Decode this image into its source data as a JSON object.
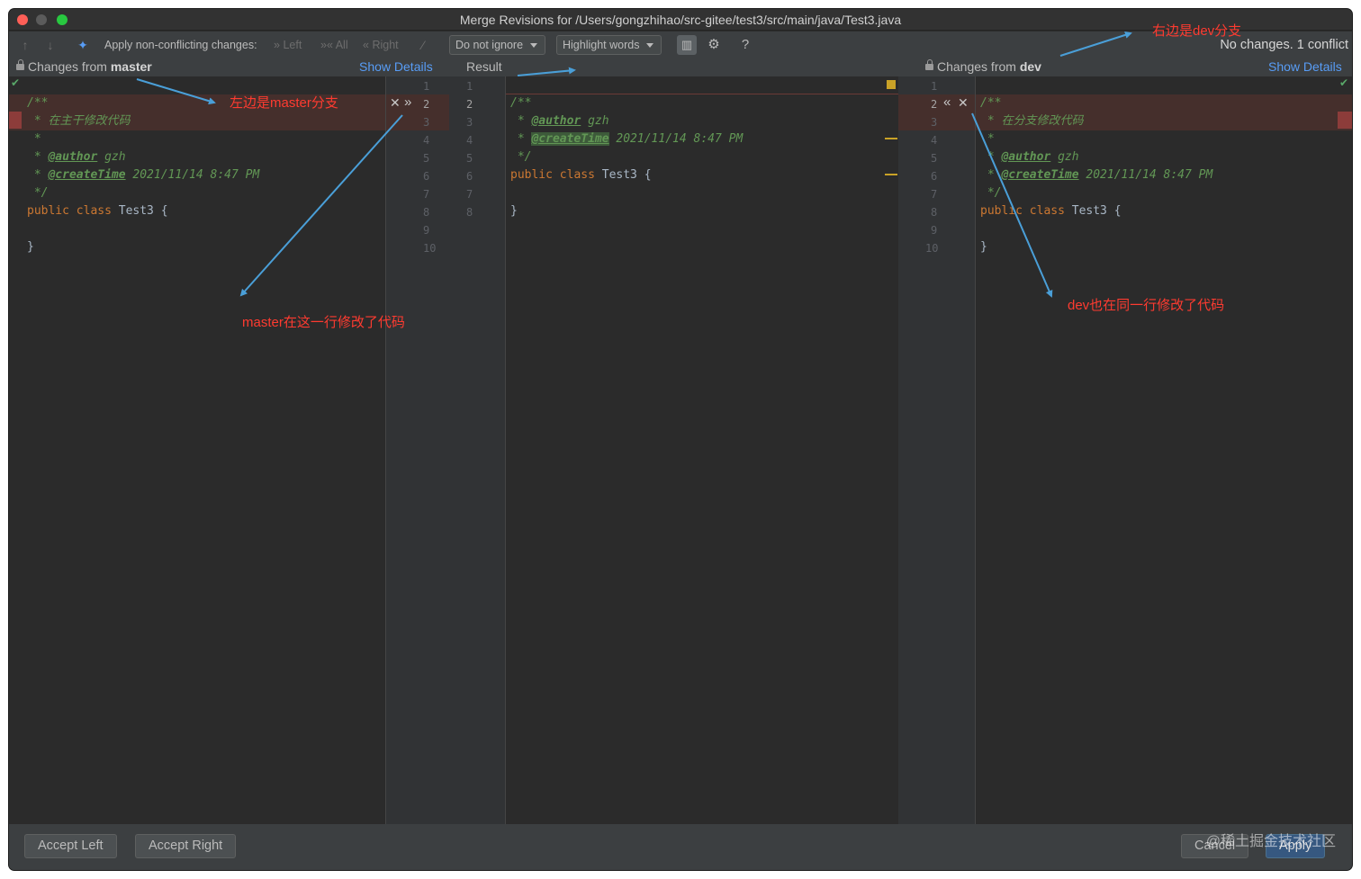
{
  "window": {
    "title": "Merge Revisions for /Users/gongzhihao/src-gitee/test3/src/main/java/Test3.java"
  },
  "toolbar": {
    "apply_label": "Apply non-conflicting changes:",
    "left_label": "Left",
    "all_label": "All",
    "right_label": "Right",
    "ignore_value": "Do not ignore",
    "highlight_value": "Highlight words",
    "help_label": "?",
    "status": "No changes. 1 conflict"
  },
  "panes": {
    "left": {
      "header_prefix": "Changes from ",
      "branch": "master",
      "details_link": "Show Details",
      "lines": [
        "/**",
        " * 在主干修改代码",
        " *",
        " * @author gzh",
        " * @createTime 2021/11/14 8:47 PM",
        " */",
        "public class Test3 {",
        "",
        "}",
        ""
      ]
    },
    "result": {
      "header": "Result",
      "lines": [
        "/**",
        " * @author gzh",
        " * @createTime 2021/11/14 8:47 PM",
        " */",
        "public class Test3 {",
        "",
        "}",
        ""
      ]
    },
    "right": {
      "header_prefix": "Changes from ",
      "branch": "dev",
      "details_link": "Show Details",
      "lines": [
        "/**",
        " * 在分支修改代码",
        " *",
        " * @author gzh",
        " * @createTime 2021/11/14 8:47 PM",
        " */",
        "public class Test3 {",
        "",
        "}",
        ""
      ]
    }
  },
  "line_numbers": {
    "left": [
      "1",
      "2",
      "3",
      "4",
      "5",
      "6",
      "7",
      "8",
      "9",
      "10"
    ],
    "result_left": [
      "1",
      "2",
      "3",
      "4",
      "5",
      "6",
      "7",
      "8"
    ],
    "result_right": [
      "1",
      "2",
      "3",
      "4",
      "5",
      "6",
      "7",
      "8"
    ],
    "right": [
      "1",
      "2",
      "3",
      "4",
      "5",
      "6",
      "7",
      "8",
      "9",
      "10"
    ]
  },
  "footer": {
    "accept_left": "Accept Left",
    "accept_right": "Accept Right",
    "cancel": "Cancel",
    "apply": "Apply",
    "watermark": "@稀土掘金技术社区"
  },
  "annotations": {
    "left_branch": "左边是master分支",
    "right_branch": "右边是dev分支",
    "master_change": "master在这一行修改了代码",
    "dev_change": "dev也在同一行修改了代码"
  },
  "colors": {
    "accent": "#589df6",
    "annotation": "#ff3b30",
    "arrow": "#4a9fd8",
    "conflict": "#452f2c"
  }
}
